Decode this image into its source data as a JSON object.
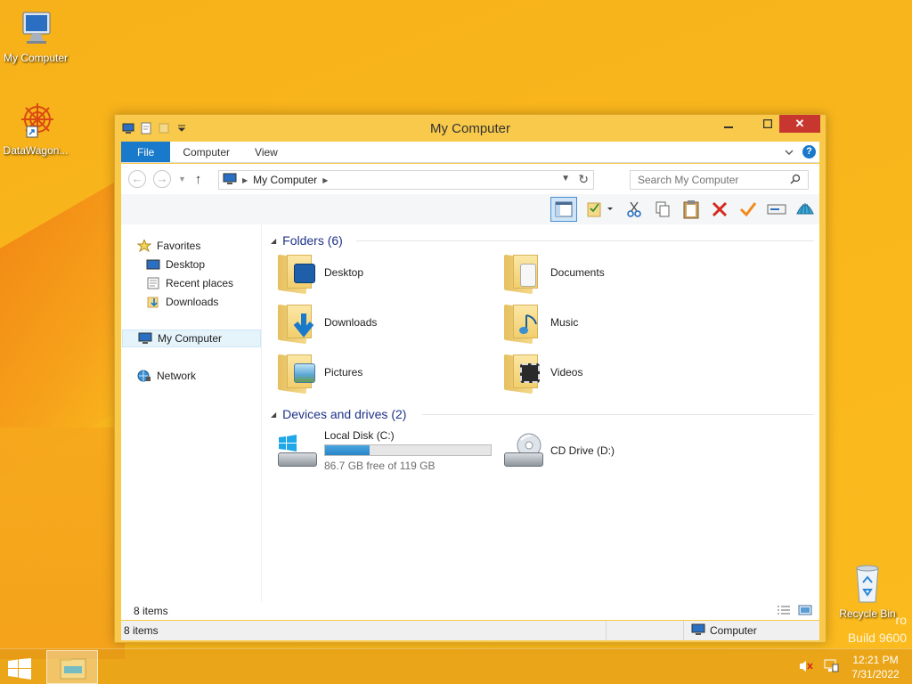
{
  "desktop": {
    "icons": [
      {
        "label": "My Computer"
      },
      {
        "label": "DataWagon..."
      },
      {
        "label": "Recycle Bin"
      }
    ],
    "watermark": {
      "line1": "ro",
      "line2": "Build 9600"
    }
  },
  "window": {
    "title": "My Computer",
    "close_glyph": "✕",
    "tabs": [
      {
        "label": "File"
      },
      {
        "label": "Computer"
      },
      {
        "label": "View"
      }
    ],
    "help_glyph": "?",
    "address": {
      "crumb": "My Computer"
    },
    "search": {
      "placeholder": "Search My Computer"
    },
    "nav": {
      "favorites": "Favorites",
      "items": [
        {
          "label": "Desktop"
        },
        {
          "label": "Recent places"
        },
        {
          "label": "Downloads"
        }
      ],
      "my_computer": "My Computer",
      "network": "Network"
    },
    "groups": {
      "folders": {
        "title": "Folders (6)"
      },
      "devices": {
        "title": "Devices and drives (2)"
      }
    },
    "folders": [
      {
        "name": "Desktop"
      },
      {
        "name": "Documents"
      },
      {
        "name": "Downloads"
      },
      {
        "name": "Music"
      },
      {
        "name": "Pictures"
      },
      {
        "name": "Videos"
      }
    ],
    "drives": [
      {
        "name": "Local Disk (C:)",
        "free": "86.7 GB free of 119 GB",
        "used_fraction": 0.27
      },
      {
        "name": "CD Drive (D:)"
      }
    ],
    "status": {
      "items_inner": "8 items",
      "items_bar": "8 items",
      "zone": "Computer"
    }
  },
  "taskbar": {
    "time": "12:21 PM",
    "date": "7/31/2022"
  },
  "colors": {
    "accent": "#1979ca",
    "close": "#c7372f",
    "title_bar": "#f8c94a",
    "group_header": "#1e3287"
  }
}
